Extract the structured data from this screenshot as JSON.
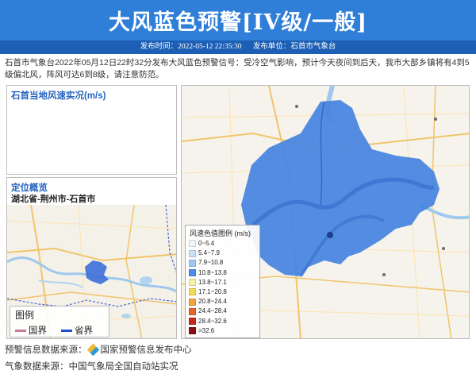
{
  "header": {
    "title": "大风蓝色预警[IV级/一般]",
    "publish_time_label": "发布时间：2022-05-12 22:35:30",
    "publish_unit_label": "发布单位：石首市气象台"
  },
  "description": "石首市气象台2022年05月12日22时32分发布大风蓝色预警信号：受冷空气影响，预计今天夜间到后天，我市大部乡镇将有4到5级偏北风，阵风可达6到8级，请注意防范。",
  "wind_panel": {
    "title": "石首当地风速实况(m/s)"
  },
  "location_panel": {
    "title": "定位概览",
    "region": "湖北省-荆州市-石首市",
    "legend_title": "图例",
    "legend_items": [
      {
        "label": "国界",
        "color": "#c77b9a"
      },
      {
        "label": "省界",
        "color": "#1f4fd6"
      }
    ]
  },
  "wind_legend": {
    "title": "风速色值图例 (m/s)",
    "items": [
      {
        "label": "0~5.4",
        "color": "#eef5fc"
      },
      {
        "label": "5.4~7.9",
        "color": "#c9e0f6"
      },
      {
        "label": "7.9~10.8",
        "color": "#9ec8f0"
      },
      {
        "label": "10.8~13.8",
        "color": "#4f8ee6"
      },
      {
        "label": "13.8~17.1",
        "color": "#f7f0a8"
      },
      {
        "label": "17.1~20.8",
        "color": "#f2dd52"
      },
      {
        "label": "20.8~24.4",
        "color": "#f2a33a"
      },
      {
        "label": "24.4~28.4",
        "color": "#e8642f"
      },
      {
        "label": "28.4~32.6",
        "color": "#c9281f"
      },
      {
        "label": ">32.6",
        "color": "#8a0f12"
      }
    ]
  },
  "footer": {
    "source1_label": "预警信息数据来源：",
    "source1_value": "国家预警信息发布中心",
    "source2_label": "气象数据来源：",
    "source2_value": "中国气象局全国自动站实况"
  },
  "colors": {
    "header_bg": "#2f7ed8",
    "subbar_bg": "#1c5fb4",
    "warning_area": "#4a86e0"
  }
}
